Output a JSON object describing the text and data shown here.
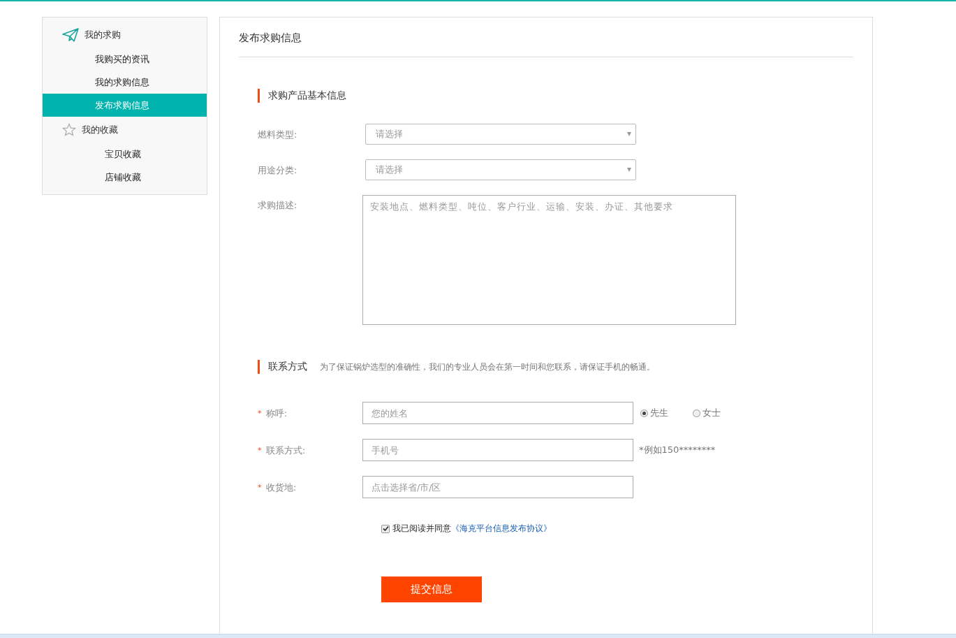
{
  "sidebar": {
    "groups": [
      {
        "title": "我的求购",
        "kind": "plane",
        "items": [
          {
            "label": "我购买的资讯",
            "selected": false
          },
          {
            "label": "我的求购信息",
            "selected": false
          },
          {
            "label": "发布求购信息",
            "selected": true
          }
        ]
      },
      {
        "title": "我的收藏",
        "kind": "star",
        "items": [
          {
            "label": "宝贝收藏",
            "selected": false
          },
          {
            "label": "店铺收藏",
            "selected": false
          }
        ]
      }
    ]
  },
  "page_title": "发布求购信息",
  "section_basic": {
    "title": "求购产品基本信息",
    "fields": [
      {
        "label": "燃料类型:",
        "kind": "select",
        "placeholder": "请选择"
      },
      {
        "label": "用途分类:",
        "kind": "select",
        "placeholder": "请选择"
      },
      {
        "label": "求购描述:",
        "kind": "textarea",
        "placeholder": "安装地点、燃料类型、吨位、客户行业、运输、安装、办证、其他要求"
      }
    ]
  },
  "section_contact": {
    "title": "联系方式",
    "note": "为了保证锅炉选型的准确性，我们的专业人员会在第一时间和您联系，请保证手机的畅通。",
    "fields": [
      {
        "label": "称呼:",
        "required": "*",
        "kind": "radio",
        "placeholder": "您的姓名",
        "options": [
          {
            "label": "先生",
            "selected": true
          },
          {
            "label": "女士",
            "selected": false
          }
        ]
      },
      {
        "label": "联系方式:",
        "required": "*",
        "kind": "hint",
        "placeholder": "手机号",
        "hint": "*例如150********"
      },
      {
        "label": "收货地:",
        "required": "*",
        "kind": "plain",
        "placeholder": "点击选择省/市/区"
      }
    ]
  },
  "agreement": {
    "checked": true,
    "text": "我已阅读并同意",
    "link": "《海克平台信息发布协议》"
  },
  "submit": "提交信息"
}
